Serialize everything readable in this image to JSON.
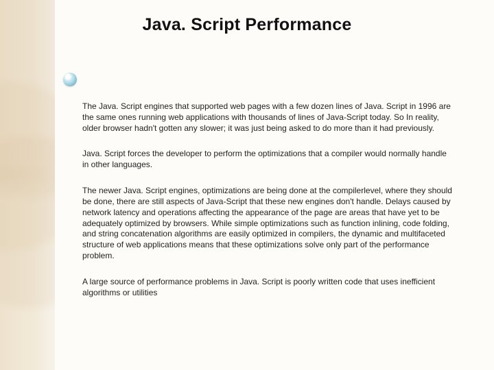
{
  "slide": {
    "title": "Java. Script Performance",
    "paragraphs": [
      "The Java. Script engines that supported web pages with a few dozen lines of Java. Script in 1996 are the same ones running web applications with thousands of lines of Java-Script today. So In reality,  older browser hadn't gotten any slower; it was just being asked to do more than it had previously.",
      "Java. Script forces the developer to perform the optimizations that a compiler would normally handle in other languages.",
      "The newer Java. Script engines, optimizations are being done at the compilerlevel, where they should be done, there are still aspects of Java-Script that these new engines don't handle. Delays caused by network latency and operations affecting the appearance of the page are areas that have yet to be adequately optimized by browsers. While simple optimizations such as function inlining, code folding, and string concatenation algorithms are easily optimized in compilers, the dynamic and multifaceted structure of web applications means that these optimizations solve only part of the performance problem.",
      "A large source of performance problems in Java. Script is poorly written code that uses inefficient algorithms or utilities"
    ]
  }
}
